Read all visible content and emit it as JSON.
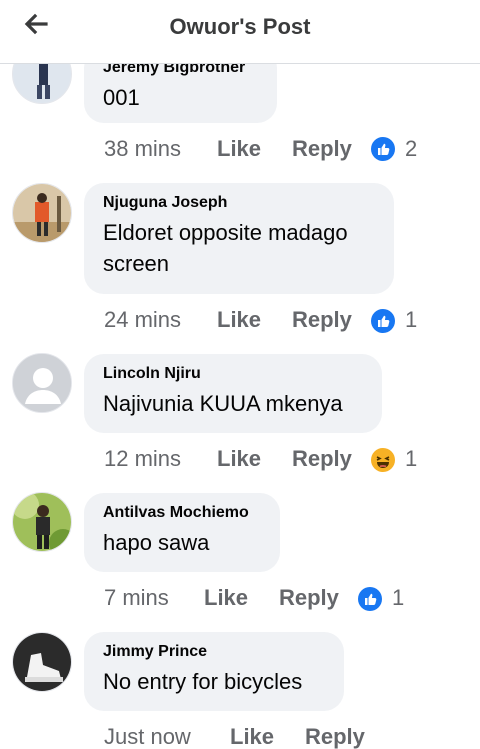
{
  "header": {
    "title": "Owuor's Post"
  },
  "comments": [
    {
      "author": "Jeremy Bigbrother",
      "text": "001",
      "time": "38 mins",
      "like": "Like",
      "reply": "Reply",
      "reaction": "like",
      "reaction_count": "2"
    },
    {
      "author": "Njuguna Joseph",
      "text_lines": [
        "Eldoret opposite madago",
        "screen"
      ],
      "time": "24 mins",
      "like": "Like",
      "reply": "Reply",
      "reaction": "like",
      "reaction_count": "1"
    },
    {
      "author": "Lincoln Njiru",
      "text": "Najivunia KUUA mkenya",
      "time": "12 mins",
      "like": "Like",
      "reply": "Reply",
      "reaction": "haha",
      "reaction_count": "1"
    },
    {
      "author": "Antilvas Mochiemo",
      "text": "hapo sawa",
      "time": "7 mins",
      "like": "Like",
      "reply": "Reply",
      "reaction": "like",
      "reaction_count": "1"
    },
    {
      "author": "Jimmy Prince",
      "text": "No entry for bicycles",
      "time": "Just now",
      "like": "Like",
      "reply": "Reply"
    }
  ],
  "colors": {
    "like_blue": "#1877f2",
    "haha_yellow": "#f7b125",
    "bubble": "#f0f2f5",
    "meta_grey": "#65676b"
  }
}
